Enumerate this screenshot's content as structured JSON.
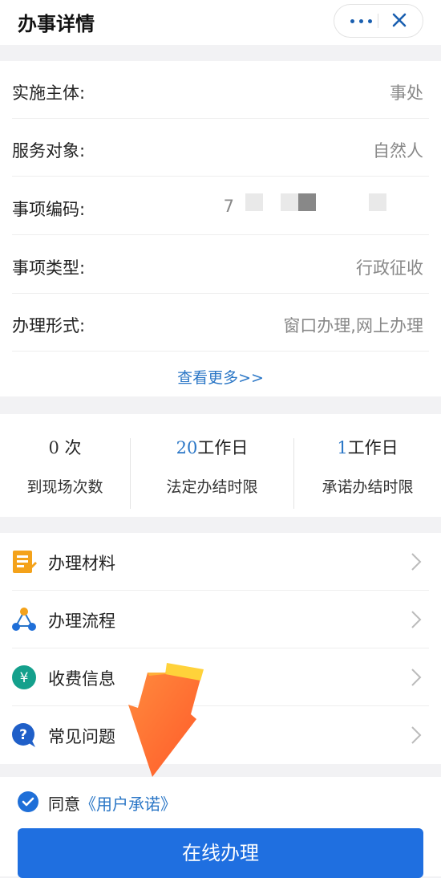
{
  "header": {
    "title": "办事详情"
  },
  "details": [
    {
      "label": "实施主体:",
      "value": "事处"
    },
    {
      "label": "服务对象:",
      "value": "自然人"
    },
    {
      "label": "事项编码:",
      "value": "7"
    },
    {
      "label": "事项类型:",
      "value": "行政征收"
    },
    {
      "label": "办理形式:",
      "value": "窗口办理,网上办理"
    }
  ],
  "see_more": "查看更多>>",
  "stats": [
    {
      "num": "0",
      "unit": "次",
      "caption": "到现场次数"
    },
    {
      "num": "20",
      "unit": "工作日",
      "caption": "法定办结时限"
    },
    {
      "num": "1",
      "unit": "工作日",
      "caption": "承诺办结时限"
    }
  ],
  "menu": [
    {
      "label": "办理材料",
      "icon": "document-icon"
    },
    {
      "label": "办理流程",
      "icon": "flow-icon"
    },
    {
      "label": "收费信息",
      "icon": "yuan-icon"
    },
    {
      "label": "常见问题",
      "icon": "question-icon"
    }
  ],
  "agree": {
    "prefix": "同意",
    "link": "《用户承诺》"
  },
  "button": "在线办理",
  "colors": {
    "accent": "#1f6fe0",
    "link": "#2a76c6"
  }
}
